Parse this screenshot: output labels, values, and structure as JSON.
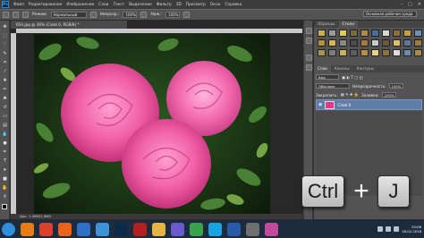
{
  "menubar": {
    "logo": "Ps",
    "items": [
      "Файл",
      "Редактирование",
      "Изображение",
      "Слои",
      "Текст",
      "Выделение",
      "Фильтр",
      "3D",
      "Просмотр",
      "Окно",
      "Справка"
    ]
  },
  "options": {
    "mode_label": "Режим:",
    "mode_value": "Нормальный",
    "opacity_label": "Непрозр.:",
    "opacity_value": "100%",
    "flow_label": "Наж.:",
    "flow_value": "100%",
    "workspace": "Основная рабочая среда"
  },
  "document": {
    "tab_title": "654.jpg @ 36% (Слой 0, RGB/8) *",
    "status": "Док: 1,48M/1,98M"
  },
  "panels": {
    "top_tabs": [
      "Образцы",
      "Стили"
    ],
    "layer_tabs": [
      "Слои",
      "Каналы",
      "Контуры"
    ],
    "kind_label": "Вид",
    "blend_value": "Обычные",
    "opacity_label": "Непрозрачность:",
    "opacity_value": "100%",
    "lock_label": "Закрепить:",
    "fill_label": "Заливка:",
    "fill_value": "100%",
    "layer_name": "Слой 0",
    "style_swatches": [
      "#c8b04a",
      "#9a9a9a",
      "#e3c85e",
      "#7a6a3c",
      "#b08a4a",
      "#4a6e9a",
      "#d8d8d8",
      "#8e6f3a",
      "#c7a040",
      "#6f8fb3",
      "#b49038",
      "#d6b45c",
      "#8a8a8a",
      "#4b4b4b",
      "#a37b3c",
      "#c9c9c9",
      "#6b5a3a",
      "#e0c070",
      "#5a7aa0",
      "#9c7d45",
      "#aa9550",
      "#7c7c7c",
      "#cbb060",
      "#5e5e5e",
      "#b98c40",
      "#e6d28a",
      "#8f7242",
      "#dcdcdc",
      "#6d8cab",
      "#a88a4c"
    ]
  },
  "shortcut": {
    "key1": "Ctrl",
    "plus": "+",
    "key2": "J"
  },
  "taskbar": {
    "apps": [
      {
        "name": "start-orb",
        "color": "#2f8fd8"
      },
      {
        "name": "vlc",
        "color": "#e77d12"
      },
      {
        "name": "chrome",
        "color": "#d9402e"
      },
      {
        "name": "firefox",
        "color": "#e8631c"
      },
      {
        "name": "media-player",
        "color": "#2e6fc8"
      },
      {
        "name": "mail",
        "color": "#3e92d8"
      },
      {
        "name": "photoshop",
        "color": "#0c2a4a"
      },
      {
        "name": "adobe-reader",
        "color": "#b51f1f"
      },
      {
        "name": "explorer",
        "color": "#e5b442"
      },
      {
        "name": "media",
        "color": "#6a5acd"
      },
      {
        "name": "fileshare",
        "color": "#3aa24a"
      },
      {
        "name": "skype",
        "color": "#1aa4e0"
      },
      {
        "name": "word",
        "color": "#2a5ba8"
      },
      {
        "name": "calculator",
        "color": "#6e6e6e"
      },
      {
        "name": "paint",
        "color": "#c24c9a"
      }
    ],
    "time": "20:06",
    "date": "16.02.2016"
  },
  "colors": {
    "accent": "#5f7da8",
    "rose": "#f05ea8"
  }
}
